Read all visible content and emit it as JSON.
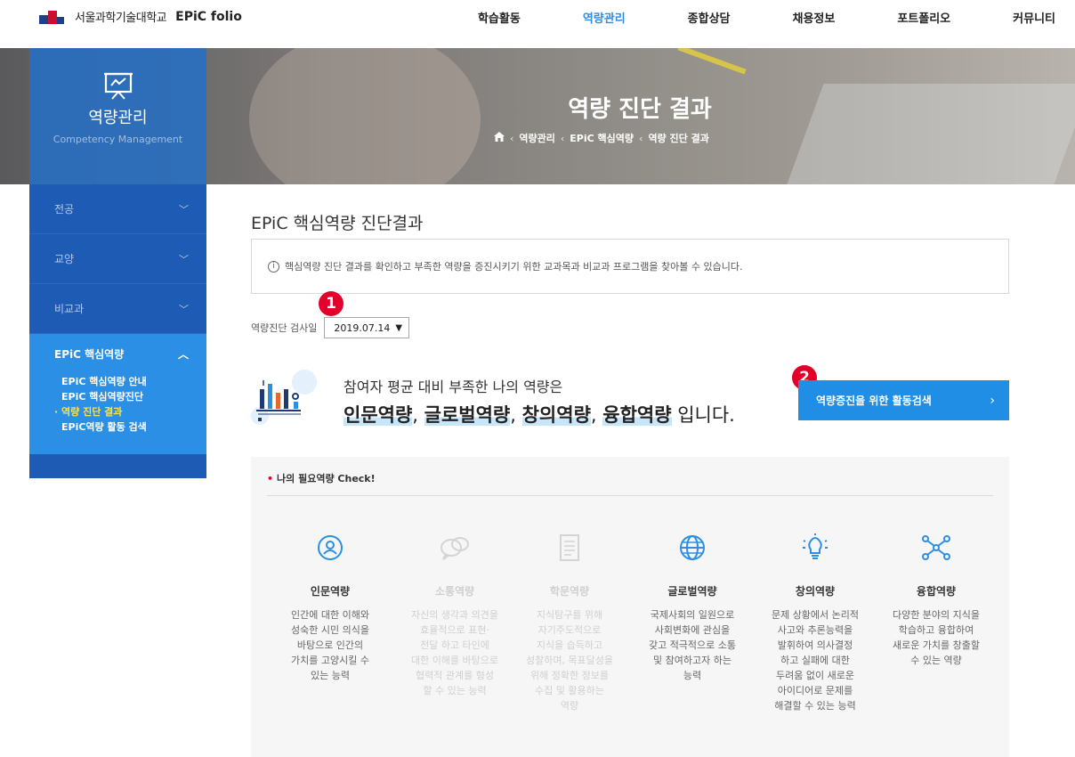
{
  "header": {
    "univ_name": "서울과학기술대학교",
    "app_name": "EPiC folio",
    "nav": [
      "학습활동",
      "역량관리",
      "종합상담",
      "채용정보",
      "포트폴리오",
      "커뮤니티"
    ],
    "nav_active": "역량관리"
  },
  "hero": {
    "title": "역량 진단 결과",
    "breadcrumb": [
      "역량관리",
      "EPiC 핵심역량",
      "역량 진단 결과"
    ]
  },
  "sidebar": {
    "title": "역량관리",
    "subtitle": "Competency Management",
    "items": [
      "전공",
      "교양",
      "비교과"
    ],
    "active": {
      "label": "EPiC 핵심역량",
      "subitems": [
        "EPiC 핵심역량 안내",
        "EPiC 핵심역량진단",
        "역량 진단 결과",
        "EPiC역량 활동 검색"
      ],
      "current_index": 2
    }
  },
  "main": {
    "title": "EPiC 핵심역량 진단결과",
    "notice": "핵심역량 진단 결과를 확인하고 부족한 역량을 증진시키기 위한 교과목과 비교과 프로그램을 찾아볼 수 있습니다.",
    "date_label": "역량진단 검사일",
    "date_value": "2019.07.14",
    "result_line1": "참여자 평균 대비 부족한 나의 역량은",
    "result_weak": [
      "인문역량",
      "글로벌역량",
      "창의역량",
      "융합역량"
    ],
    "result_suffix": "입니다.",
    "search_button": "역량증진을 위한 활동검색",
    "markers": [
      "1",
      "2"
    ]
  },
  "panel": {
    "title": "나의 필요역량 Check!",
    "competencies": [
      {
        "name": "인문역량",
        "icon": "person-icon",
        "desc": "인간에 대한 이해와\n성숙한 시민 의식을\n바탕으로 인간의\n가치를 고양시킬 수\n있는 능력",
        "dim": false
      },
      {
        "name": "소통역량",
        "icon": "speech-bubble-icon",
        "desc": "자신의 생각과 의견을\n효율적으로 표현·\n전달 하고 타인에\n대한 이해를 바탕으로\n협력적 관계를 형성\n할 수 있는 능력",
        "dim": true
      },
      {
        "name": "학문역량",
        "icon": "document-icon",
        "desc": "지식탐구를 위해\n자기주도적으로\n지식을 습득하고\n성찰하며, 목표달성을\n위해 정확한 정보를\n수집 및 활용하는\n역량",
        "dim": true
      },
      {
        "name": "글로벌역량",
        "icon": "globe-icon",
        "desc": "국제사회의 일원으로\n사회변화에 관심을\n갖고 적극적으로 소통\n및 참여하고자 하는\n능력",
        "dim": false
      },
      {
        "name": "창의역량",
        "icon": "lightbulb-icon",
        "desc": "문제 상황에서 논리적\n사고와 추론능력을\n발휘하여 의사결정\n하고 실패에 대한\n두려움 없이 새로운\n아이디어로 문제를\n해결할 수 있는 능력",
        "dim": false
      },
      {
        "name": "융합역량",
        "icon": "network-icon",
        "desc": "다양한 분야의 지식을\n학습하고 융합하여\n새로운 가치를 창출할\n수 있는 역량",
        "dim": false
      }
    ]
  },
  "colors": {
    "accent": "#2f8be6",
    "sidebar": "#1e5bb4",
    "sidebar_active": "#2a8fe5",
    "button": "#1f8ee4",
    "marker": "#e3002b"
  }
}
